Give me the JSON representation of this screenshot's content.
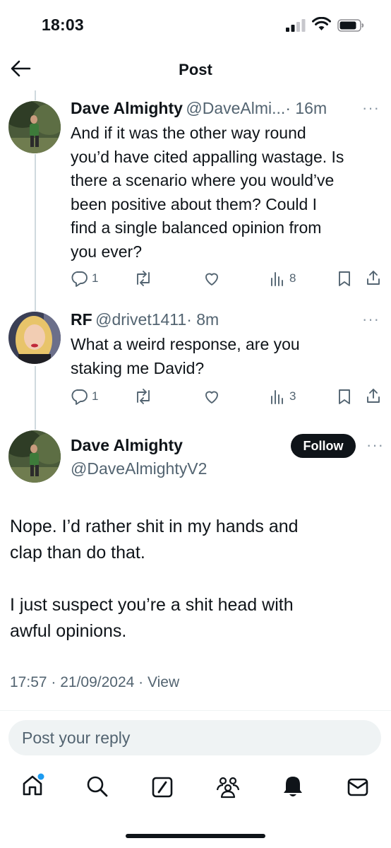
{
  "status_bar": {
    "time": "18:03"
  },
  "header": {
    "title": "Post"
  },
  "thread": [
    {
      "name": "Dave Almighty",
      "handle": "@DaveAlmi...",
      "time": "· 16m",
      "text_lines": [
        "And if it was the other way round",
        "you’d have cited appalling wastage. Is",
        "there a scenario where you would’ve",
        "been positive about them? Could I",
        "find a single balanced opinion from",
        "you ever?"
      ],
      "replies": "1",
      "views": "8"
    },
    {
      "name": "RF",
      "handle": "@drivet1411",
      "time": "· 8m",
      "text_lines": [
        "What a weird response, are you",
        "staking me David?"
      ],
      "replies": "1",
      "views": "3"
    }
  ],
  "main_post": {
    "name": "Dave Almighty",
    "handle": "@DaveAlmightyV2",
    "follow_label": "Follow",
    "paragraphs": [
      [
        "Nope. I’d rather shit in my hands and",
        "clap than do that."
      ],
      [
        "I just suspect you’re a shit head with",
        "awful opinions."
      ]
    ],
    "timestamp": "17:57 · 21/09/2024 · View"
  },
  "reply_box": {
    "placeholder": "Post your reply"
  },
  "bottom_nav": [
    "home-icon",
    "search-icon",
    "grok-icon",
    "communities-icon",
    "notifications-icon",
    "messages-icon"
  ],
  "colors": {
    "accent": "#1d9bf0",
    "text": "#0f1419",
    "secondary": "#536471"
  }
}
